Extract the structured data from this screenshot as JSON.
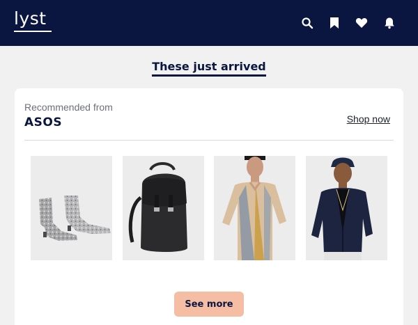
{
  "header": {
    "logo": "lyst",
    "icons": [
      "search-icon",
      "bookmark-icon",
      "heart-icon",
      "bell-icon"
    ]
  },
  "section": {
    "title": "These just arrived"
  },
  "card": {
    "recommended_label": "Recommended from",
    "store": "ASOS",
    "shop_now": "Shop now",
    "products": [
      {
        "name": "glitter-chelsea-boots"
      },
      {
        "name": "black-leather-backpack"
      },
      {
        "name": "tie-dye-sheer-shirt"
      },
      {
        "name": "navy-bomber-jacket"
      }
    ],
    "see_more": "See more"
  },
  "colors": {
    "header_bg": "#0b1640",
    "page_bg": "#f1f1f1",
    "accent_button": "#f5bda4",
    "navy_text": "#0b1640"
  }
}
